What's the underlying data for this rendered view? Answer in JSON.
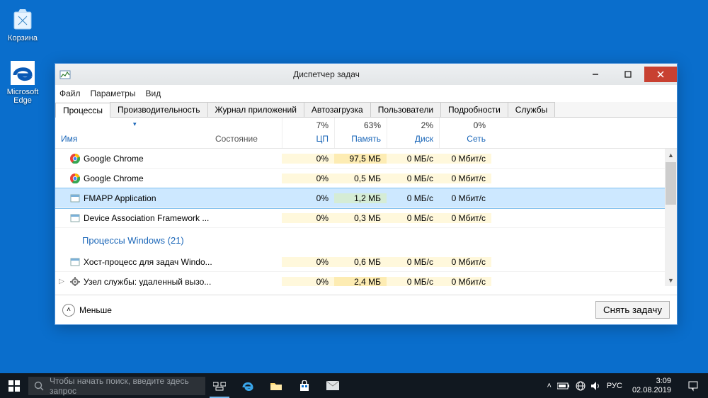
{
  "desktop": {
    "recycle_label": "Корзина",
    "edge_label": "Microsoft Edge"
  },
  "window": {
    "title": "Диспетчер задач",
    "menu": {
      "file": "Файл",
      "options": "Параметры",
      "view": "Вид"
    },
    "tabs": {
      "processes": "Процессы",
      "performance": "Производительность",
      "app_history": "Журнал приложений",
      "startup": "Автозагрузка",
      "users": "Пользователи",
      "details": "Подробности",
      "services": "Службы"
    },
    "columns": {
      "name": "Имя",
      "state": "Состояние",
      "cpu_pct": "7%",
      "cpu_lbl": "ЦП",
      "mem_pct": "63%",
      "mem_lbl": "Память",
      "disk_pct": "2%",
      "disk_lbl": "Диск",
      "net_pct": "0%",
      "net_lbl": "Сеть"
    },
    "rows": [
      {
        "type": "proc",
        "icon": "chrome",
        "name": "Google Chrome",
        "cpu": "0%",
        "mem": "97,5 МБ",
        "disk": "0 МБ/с",
        "net": "0 Мбит/с",
        "mem_heat": 2
      },
      {
        "type": "proc",
        "icon": "chrome",
        "name": "Google Chrome",
        "cpu": "0%",
        "mem": "0,5 МБ",
        "disk": "0 МБ/с",
        "net": "0 Мбит/с",
        "mem_heat": 1
      },
      {
        "type": "proc",
        "icon": "app",
        "name": "FMAPP Application",
        "cpu": "0%",
        "mem": "1,2 МБ",
        "disk": "0 МБ/с",
        "net": "0 Мбит/с",
        "selected": true,
        "mem_heat": 1
      },
      {
        "type": "proc",
        "icon": "app",
        "name": "Device Association Framework ...",
        "cpu": "0%",
        "mem": "0,3 МБ",
        "disk": "0 МБ/с",
        "net": "0 Мбит/с",
        "mem_heat": 1
      },
      {
        "type": "group",
        "name": "Процессы Windows (21)"
      },
      {
        "type": "proc",
        "icon": "app",
        "name": "Хост-процесс для задач Windo...",
        "cpu": "0%",
        "mem": "0,6 МБ",
        "disk": "0 МБ/с",
        "net": "0 Мбит/с",
        "mem_heat": 1
      },
      {
        "type": "proc",
        "icon": "svc",
        "name": "Узел службы: удаленный вызо...",
        "expander": true,
        "cpu": "0%",
        "mem": "2,4 МБ",
        "disk": "0 МБ/с",
        "net": "0 Мбит/с",
        "mem_heat": 2
      }
    ],
    "footer": {
      "fewer": "Меньше",
      "end_task": "Снять задачу"
    }
  },
  "taskbar": {
    "search_placeholder": "Чтобы начать поиск, введите здесь запрос",
    "lang": "РУС",
    "time": "3:09",
    "date": "02.08.2019"
  }
}
